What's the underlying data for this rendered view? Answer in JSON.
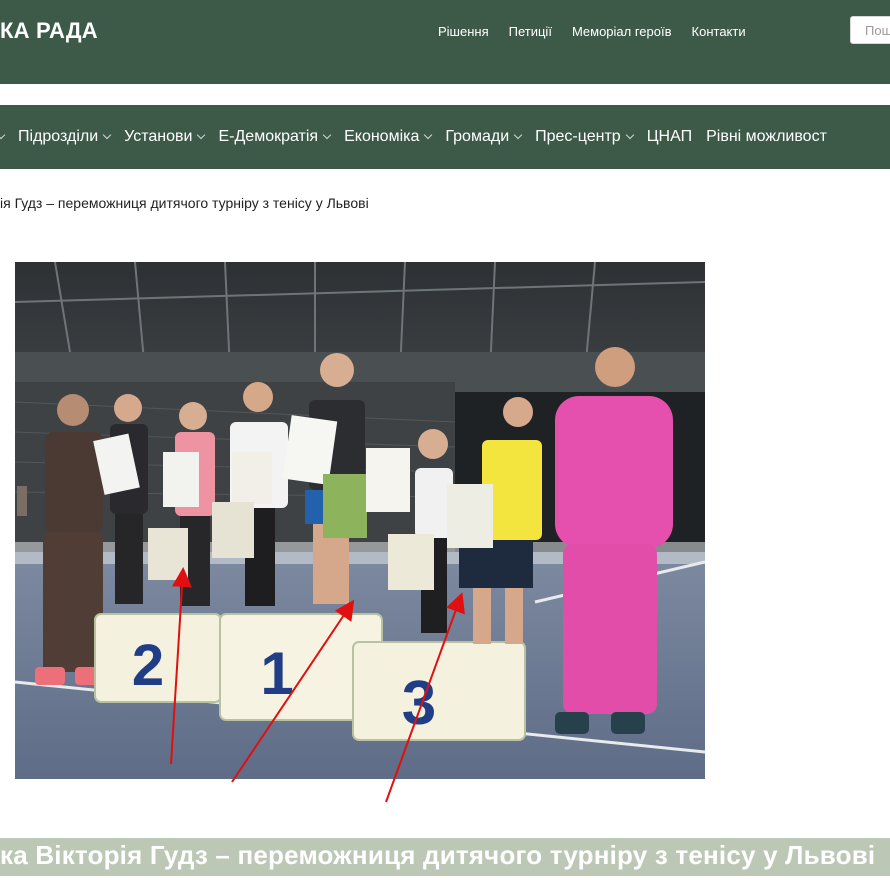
{
  "header": {
    "logo_text": "КА РАДА",
    "links": [
      "Рішення",
      "Петиції",
      "Меморіал героїв",
      "Контакти"
    ],
    "search_placeholder": "Пош"
  },
  "nav": {
    "items": [
      {
        "label": "",
        "has_dropdown": true
      },
      {
        "label": "Підрозділи",
        "has_dropdown": true
      },
      {
        "label": "Установи",
        "has_dropdown": true
      },
      {
        "label": "Е-Демократія",
        "has_dropdown": true
      },
      {
        "label": "Економіка",
        "has_dropdown": true
      },
      {
        "label": "Громади",
        "has_dropdown": true
      },
      {
        "label": "Прес-центр",
        "has_dropdown": true
      },
      {
        "label": "ЦНАП",
        "has_dropdown": false
      },
      {
        "label": "Рівні можливост",
        "has_dropdown": false
      }
    ]
  },
  "breadcrumb": "ія Гудз – переможниця дитячого турніру з тенісу у Львові",
  "photo": {
    "podium_labels": [
      "2",
      "1",
      "3"
    ]
  },
  "caption": "ка Вікторія Гудз – переможниця дитячого турніру з тенісу у Львові",
  "colors": {
    "header_bg": "#3d5a48",
    "caption_bg": "#bcc8b5",
    "arrow": "#e01010"
  }
}
